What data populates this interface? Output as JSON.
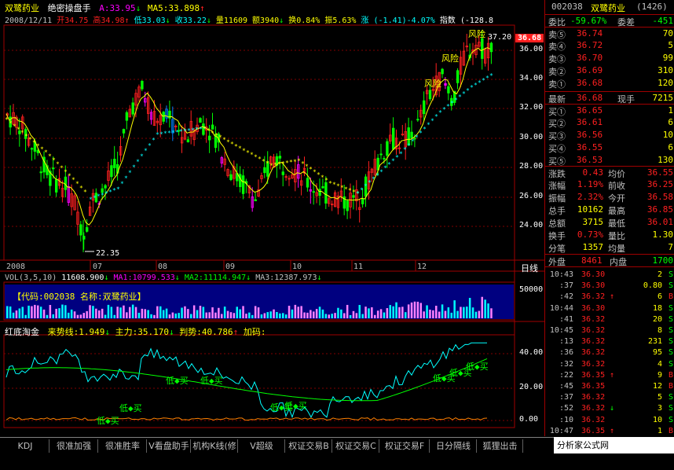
{
  "colors": {
    "up": "#ff2020",
    "down": "#00ff00",
    "yellow": "#ffff00",
    "cyan": "#00ffff",
    "magenta": "#ff00ff",
    "white": "#ffffff",
    "grid": "#800000",
    "frame": "#a00000",
    "navy": "#000080",
    "blue_icon": "#0060ff"
  },
  "header": {
    "stock": "双鹭药业",
    "indicator_name": "绝密操盘手",
    "a_label": "A:33.95",
    "a_arrow": "↓",
    "ma5_label": "MA5:33.898",
    "ma5_arrow": "↑",
    "date": "2008/12/11",
    "open_label": "开34.75",
    "high_label": "高34.98",
    "high_arrow": "↑",
    "low_label": "低33.03",
    "low_arrow": "↓",
    "close_label": "收33.22",
    "close_arrow": "↓",
    "vol_label": "量11609",
    "amount_label": "额3940",
    "amount_arrow": "↓",
    "turnover_label": "换0.84%",
    "amp_label": "振5.63%",
    "change_label": "涨 (-1.41)-4.07%",
    "index_label": "指数 (-128.8"
  },
  "main_chart": {
    "y_labels": [
      "36.00",
      "34.00",
      "32.00",
      "30.00",
      "28.00",
      "26.00",
      "24.00"
    ],
    "price_tag": "36.68",
    "low_annotation": "22.35",
    "high_annotation": "37.20",
    "risk_labels": [
      "风险",
      "风险",
      "风险"
    ],
    "month_labels": [
      "2008",
      "07",
      "08",
      "09",
      "10",
      "11",
      "12"
    ],
    "period_label": "日线"
  },
  "volume": {
    "header": "VOL(3,5,10)",
    "vol_value": "11608.900",
    "vol_arrow": "↓",
    "ma1_label": "MA1:10799.533",
    "ma1_arrow": "↓",
    "ma2_label": "MA2:11114.947",
    "ma2_arrow": "↓",
    "ma3_label": "MA3:12387.973",
    "ma3_arrow": "↓",
    "banner_code": "【代码:002038 ",
    "banner_name": "名称:双鹭药业】",
    "y_label": "50000"
  },
  "indicator": {
    "name": "红底淘金",
    "trend_label": "来势线:1.949",
    "trend_arrow": "↓",
    "main_label": "主力:35.170",
    "main_arrow": "↓",
    "judge_label": "判势:40.786",
    "judge_arrow": "↑",
    "add_label": "加码:",
    "y_labels": [
      "40.00",
      "20.00",
      "0.00"
    ],
    "buy_labels": [
      "低◆买",
      "低◆买",
      "低◆买",
      "低◆买",
      "低◆买",
      "低◆买",
      "低◆买",
      "低◆买",
      "低◆买"
    ]
  },
  "quote": {
    "code": "002038",
    "name": "双鹭药业",
    "board": "(1426)",
    "weibi_label": "委比",
    "weibi_value": "-59.67%",
    "weicha_label": "委差",
    "weicha_value": "-451",
    "asks": [
      {
        "label": "卖⑤",
        "price": "36.74",
        "vol": "70"
      },
      {
        "label": "卖④",
        "price": "36.72",
        "vol": "5"
      },
      {
        "label": "卖③",
        "price": "36.70",
        "vol": "99"
      },
      {
        "label": "卖②",
        "price": "36.69",
        "vol": "310"
      },
      {
        "label": "卖①",
        "price": "36.68",
        "vol": "120"
      }
    ],
    "last_label": "最新",
    "last_price": "36.68",
    "cur_label": "现手",
    "cur_vol": "7215",
    "bids": [
      {
        "label": "买①",
        "price": "36.65",
        "vol": "1"
      },
      {
        "label": "买②",
        "price": "36.61",
        "vol": "6"
      },
      {
        "label": "买③",
        "price": "36.56",
        "vol": "10"
      },
      {
        "label": "买④",
        "price": "36.55",
        "vol": "6"
      },
      {
        "label": "买⑤",
        "price": "36.53",
        "vol": "130"
      }
    ],
    "stats": [
      {
        "l1": "涨跌",
        "v1": "0.43",
        "l2": "均价",
        "v2": "36.55"
      },
      {
        "l1": "涨幅",
        "v1": "1.19%",
        "l2": "前收",
        "v2": "36.25"
      },
      {
        "l1": "振幅",
        "v1": "2.32%",
        "l2": "今开",
        "v2": "36.58"
      },
      {
        "l1": "总手",
        "v1": "10162",
        "l2": "最高",
        "v2": "36.85"
      },
      {
        "l1": "总额",
        "v1": "3715",
        "l2": "最低",
        "v2": "36.01"
      },
      {
        "l1": "换手",
        "v1": "0.73%",
        "l2": "量比",
        "v2": "1.30"
      },
      {
        "l1": "分笔",
        "v1": "1357",
        "l2": "均量",
        "v2": "7"
      }
    ],
    "outer_label": "外盘",
    "outer_value": "8461",
    "inner_label": "内盘",
    "inner_value": "1700",
    "ticks": [
      {
        "t": "10:43",
        "p": "36.30",
        "v": "2",
        "s": "S"
      },
      {
        "t": ":37",
        "p": "36.30",
        "v": "0.80",
        "s": "S"
      },
      {
        "t": ":42",
        "p": "36.32",
        "v": "6",
        "s": "B",
        "a": "↑"
      },
      {
        "t": "10:44",
        "p": "36.30",
        "v": "18",
        "s": "S"
      },
      {
        "t": ":41",
        "p": "36.32",
        "v": "20",
        "s": "S"
      },
      {
        "t": "10:45",
        "p": "36.32",
        "v": "8",
        "s": "S"
      },
      {
        "t": ":13",
        "p": "36.32",
        "v": "231",
        "s": "S"
      },
      {
        "t": ":36",
        "p": "36.32",
        "v": "95",
        "s": "S"
      },
      {
        "t": ":32",
        "p": "36.32",
        "v": "4",
        "s": "S"
      },
      {
        "t": ":22",
        "p": "36.35",
        "v": "9",
        "s": "B",
        "a": "↑"
      },
      {
        "t": ":45",
        "p": "36.35",
        "v": "12",
        "s": "B"
      },
      {
        "t": ":37",
        "p": "36.32",
        "v": "5",
        "s": "S"
      },
      {
        "t": ":52",
        "p": "36.32",
        "v": "3",
        "s": "S",
        "a": "↓"
      },
      {
        "t": ":10",
        "p": "36.32",
        "v": "10",
        "s": "S"
      },
      {
        "t": "10:47",
        "p": "36.35",
        "v": "1",
        "s": "B",
        "a": "↑"
      }
    ]
  },
  "tabs": [
    "KDJ",
    "很准加强",
    "很准胜率",
    "V看盘助手",
    "机构K线(修",
    "V超级MACD",
    "权证交易B",
    "权证交易C",
    "权证交易F",
    "日分隔线",
    "狐狸出击"
  ],
  "watermark": "分析家公式网www.88gs.com"
}
